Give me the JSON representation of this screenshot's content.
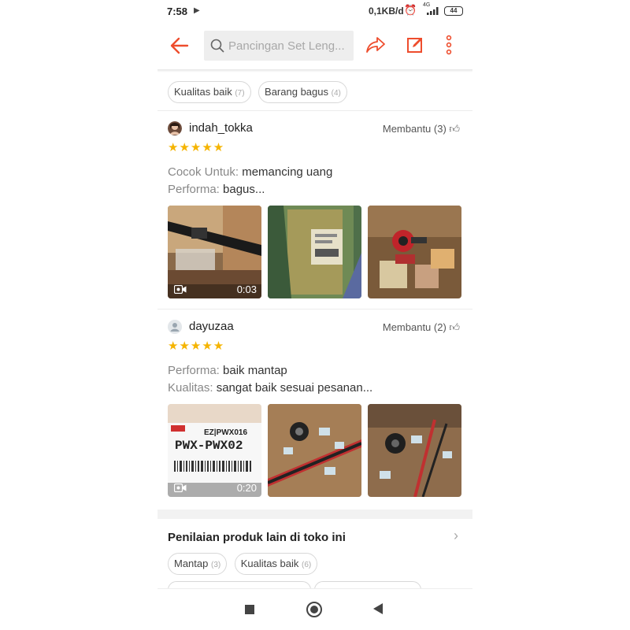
{
  "status_bar": {
    "time": "7:58",
    "net_speed": "0,1KB/d",
    "network_type": "4G",
    "battery": "44"
  },
  "header": {
    "search_placeholder": "Pancingan Set Leng...",
    "accent_color": "#ee4d2d"
  },
  "top_tags": [
    {
      "label": "Kualitas baik",
      "count": "(7)"
    },
    {
      "label": "Barang bagus",
      "count": "(4)"
    }
  ],
  "reviews": [
    {
      "username": "indah_tokka",
      "helpful_label": "Membantu (3)",
      "stars": "★★★★★",
      "details": [
        {
          "label": "Cocok Untuk:",
          "value": "memancing uang"
        },
        {
          "label": "Performa:",
          "value": "bagus..."
        }
      ],
      "media": [
        {
          "type": "video",
          "duration": "0:03"
        },
        {
          "type": "photo"
        },
        {
          "type": "photo"
        }
      ]
    },
    {
      "username": "dayuzaa",
      "helpful_label": "Membantu (2)",
      "stars": "★★★★★",
      "details": [
        {
          "label": "Performa:",
          "value": "baik mantap"
        },
        {
          "label": "Kualitas:",
          "value": "sangat baik sesuai pesanan..."
        }
      ],
      "media": [
        {
          "type": "video",
          "duration": "0:20",
          "label_lines": [
            "EZ|PWX016",
            "PWX-PWX02"
          ]
        },
        {
          "type": "photo"
        },
        {
          "type": "photo"
        }
      ]
    }
  ],
  "other_reviews": {
    "title": "Penilaian produk lain di toko ini",
    "tags": [
      {
        "label": "Mantap",
        "count": "(3)"
      },
      {
        "label": "Kualitas baik",
        "count": "(6)"
      }
    ]
  }
}
